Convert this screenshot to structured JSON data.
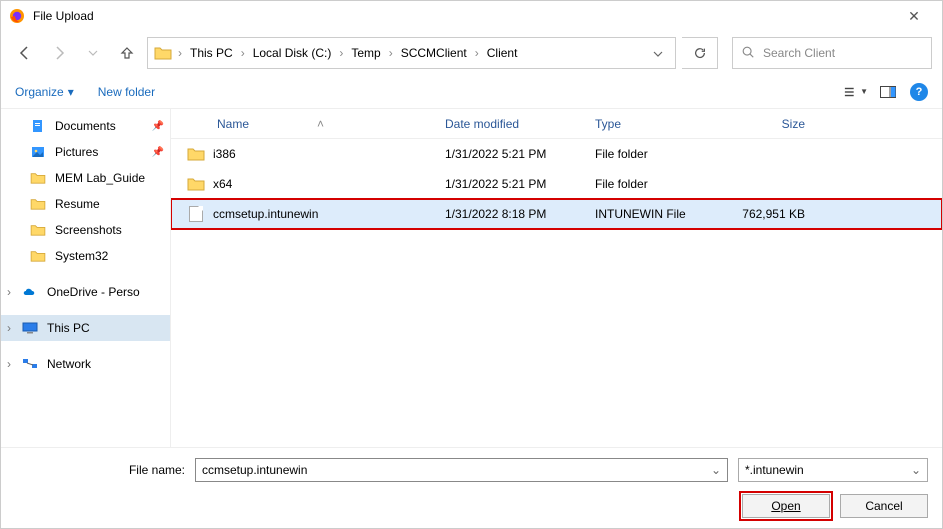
{
  "window": {
    "title": "File Upload"
  },
  "breadcrumbs": [
    "This PC",
    "Local Disk (C:)",
    "Temp",
    "SCCMClient",
    "Client"
  ],
  "search": {
    "placeholder": "Search Client"
  },
  "toolbar": {
    "organize": "Organize",
    "newfolder": "New folder"
  },
  "sidebar": {
    "items": [
      {
        "label": "Documents",
        "icon": "doc",
        "pinned": true
      },
      {
        "label": "Pictures",
        "icon": "pic",
        "pinned": true
      },
      {
        "label": "MEM Lab_Guide",
        "icon": "folder"
      },
      {
        "label": "Resume",
        "icon": "folder"
      },
      {
        "label": "Screenshots",
        "icon": "folder"
      },
      {
        "label": "System32",
        "icon": "folder"
      }
    ],
    "onedrive": "OneDrive - Perso",
    "thispc": "This PC",
    "network": "Network"
  },
  "columns": {
    "name": "Name",
    "date": "Date modified",
    "type": "Type",
    "size": "Size"
  },
  "files": [
    {
      "name": "i386",
      "date": "1/31/2022 5:21 PM",
      "type": "File folder",
      "size": "",
      "kind": "folder"
    },
    {
      "name": "x64",
      "date": "1/31/2022 5:21 PM",
      "type": "File folder",
      "size": "",
      "kind": "folder"
    },
    {
      "name": "ccmsetup.intunewin",
      "date": "1/31/2022 8:18 PM",
      "type": "INTUNEWIN File",
      "size": "762,951 KB",
      "kind": "file",
      "selected": true
    }
  ],
  "footer": {
    "filename_label": "File name:",
    "filename_value": "ccmsetup.intunewin",
    "filter": "*.intunewin",
    "open": "Open",
    "cancel": "Cancel"
  }
}
